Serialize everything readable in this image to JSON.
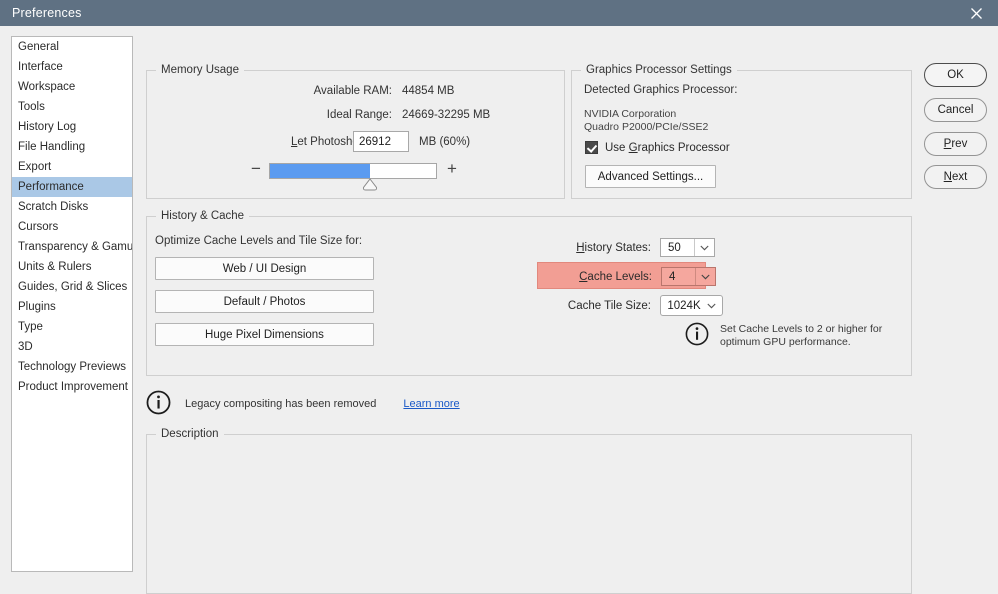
{
  "window": {
    "title": "Preferences",
    "close_icon": "close-icon"
  },
  "sidebar": {
    "items": [
      {
        "label": "General",
        "selected": false
      },
      {
        "label": "Interface",
        "selected": false
      },
      {
        "label": "Workspace",
        "selected": false
      },
      {
        "label": "Tools",
        "selected": false
      },
      {
        "label": "History Log",
        "selected": false
      },
      {
        "label": "File Handling",
        "selected": false
      },
      {
        "label": "Export",
        "selected": false
      },
      {
        "label": "Performance",
        "selected": true
      },
      {
        "label": "Scratch Disks",
        "selected": false
      },
      {
        "label": "Cursors",
        "selected": false
      },
      {
        "label": "Transparency & Gamut",
        "selected": false
      },
      {
        "label": "Units & Rulers",
        "selected": false
      },
      {
        "label": "Guides, Grid & Slices",
        "selected": false
      },
      {
        "label": "Plugins",
        "selected": false
      },
      {
        "label": "Type",
        "selected": false
      },
      {
        "label": "3D",
        "selected": false
      },
      {
        "label": "Technology Previews",
        "selected": false
      },
      {
        "label": "Product Improvement",
        "selected": false
      }
    ]
  },
  "memory_usage": {
    "legend": "Memory Usage",
    "available_ram_label": "Available RAM:",
    "available_ram_value": "44854 MB",
    "ideal_range_label": "Ideal Range:",
    "ideal_range_value": "24669-32295 MB",
    "let_use_label_pre": "L",
    "let_use_label_underlined": "L",
    "let_use_label": "Let Photoshop Use:",
    "let_use_value": "26912",
    "unit_suffix": "MB (60%)",
    "slider_percent": 60,
    "slider_minus": "−",
    "slider_plus": "+",
    "fill_color": "#5b9bf0"
  },
  "graphics": {
    "legend": "Graphics Processor Settings",
    "detected_label": "Detected Graphics Processor:",
    "vendor": "NVIDIA Corporation",
    "model": "Quadro P2000/PCIe/SSE2",
    "use_gpu_label": "Use Graphics Processor",
    "use_gpu_checked": true,
    "advanced_button": "Advanced Settings..."
  },
  "history_cache": {
    "legend": "History & Cache",
    "optimize_label": "Optimize Cache Levels and Tile Size for:",
    "presets": [
      {
        "label": "Web / UI Design"
      },
      {
        "label": "Default / Photos"
      },
      {
        "label": "Huge Pixel Dimensions"
      }
    ],
    "history_states_label": "History States:",
    "history_states_value": "50",
    "cache_levels_label": "Cache Levels:",
    "cache_levels_value": "4",
    "cache_levels_highlight_color": "#f29e94",
    "cache_tile_size_label": "Cache Tile Size:",
    "cache_tile_size_value": "1024K",
    "tip_text": "Set Cache Levels to 2 or higher for optimum GPU performance.",
    "tip_icon": "info-icon"
  },
  "legacy_notice": {
    "icon": "info-icon",
    "text": "Legacy compositing has been removed",
    "link": "Learn more"
  },
  "description": {
    "legend": "Description",
    "body": ""
  },
  "buttons": {
    "ok": "OK",
    "cancel": "Cancel",
    "prev": "Prev",
    "next": "Next"
  }
}
